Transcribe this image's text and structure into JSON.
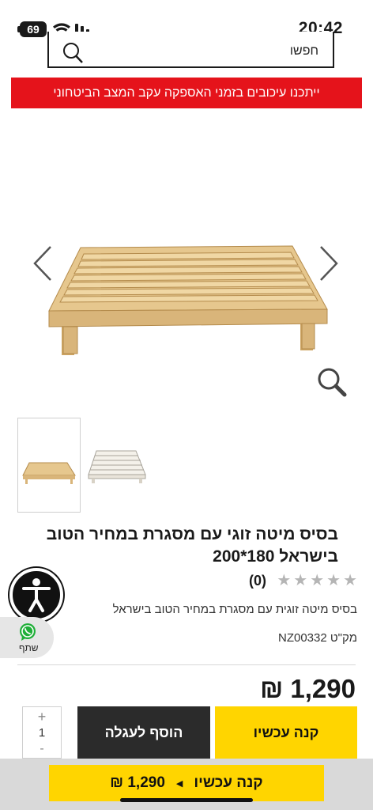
{
  "status_bar": {
    "time": "20:42",
    "battery": "69",
    "icons": [
      "battery-icon",
      "wifi-icon",
      "signal-icon"
    ]
  },
  "search": {
    "placeholder": "חפשו"
  },
  "notice_banner": {
    "text": "ייתכנו עיכובים בזמני האספקה עקב המצב הביטחוני"
  },
  "gallery": {
    "images": [
      "bed-frame-natural-wood",
      "bed-frame-white-wood"
    ],
    "icons": [
      "chevron-left-icon",
      "chevron-right-icon",
      "magnifier-zoom-icon"
    ]
  },
  "product": {
    "title": "בסיס מיטה זוגי עם מסגרת במחיר הטוב בישראל 180*200",
    "rating_stars": 5,
    "rating_filled": 0,
    "review_count": "(0)",
    "short_description": "בסיס מיטה זוגית עם מסגרת במחיר הטוב בישראל",
    "sku": "מק\"ט NZ00332",
    "price": "1,290 ₪"
  },
  "purchase": {
    "qty_plus": "+",
    "qty_value": "1",
    "qty_minus": "-",
    "add_to_cart_label": "הוסף לעגלה",
    "buy_now_label": "קנה עכשיו"
  },
  "share": {
    "label": "שתף",
    "icon": "whatsapp-icon"
  },
  "accessibility": {
    "icon": "accessibility-icon"
  },
  "sticky_bar": {
    "buy_label": "קנה עכשיו",
    "price": "1,290 ₪"
  },
  "colors": {
    "banner_red": "#e5131b",
    "accent_yellow": "#ffd500",
    "dark_button": "#2b2b2b",
    "wood": "#e6c78e"
  }
}
